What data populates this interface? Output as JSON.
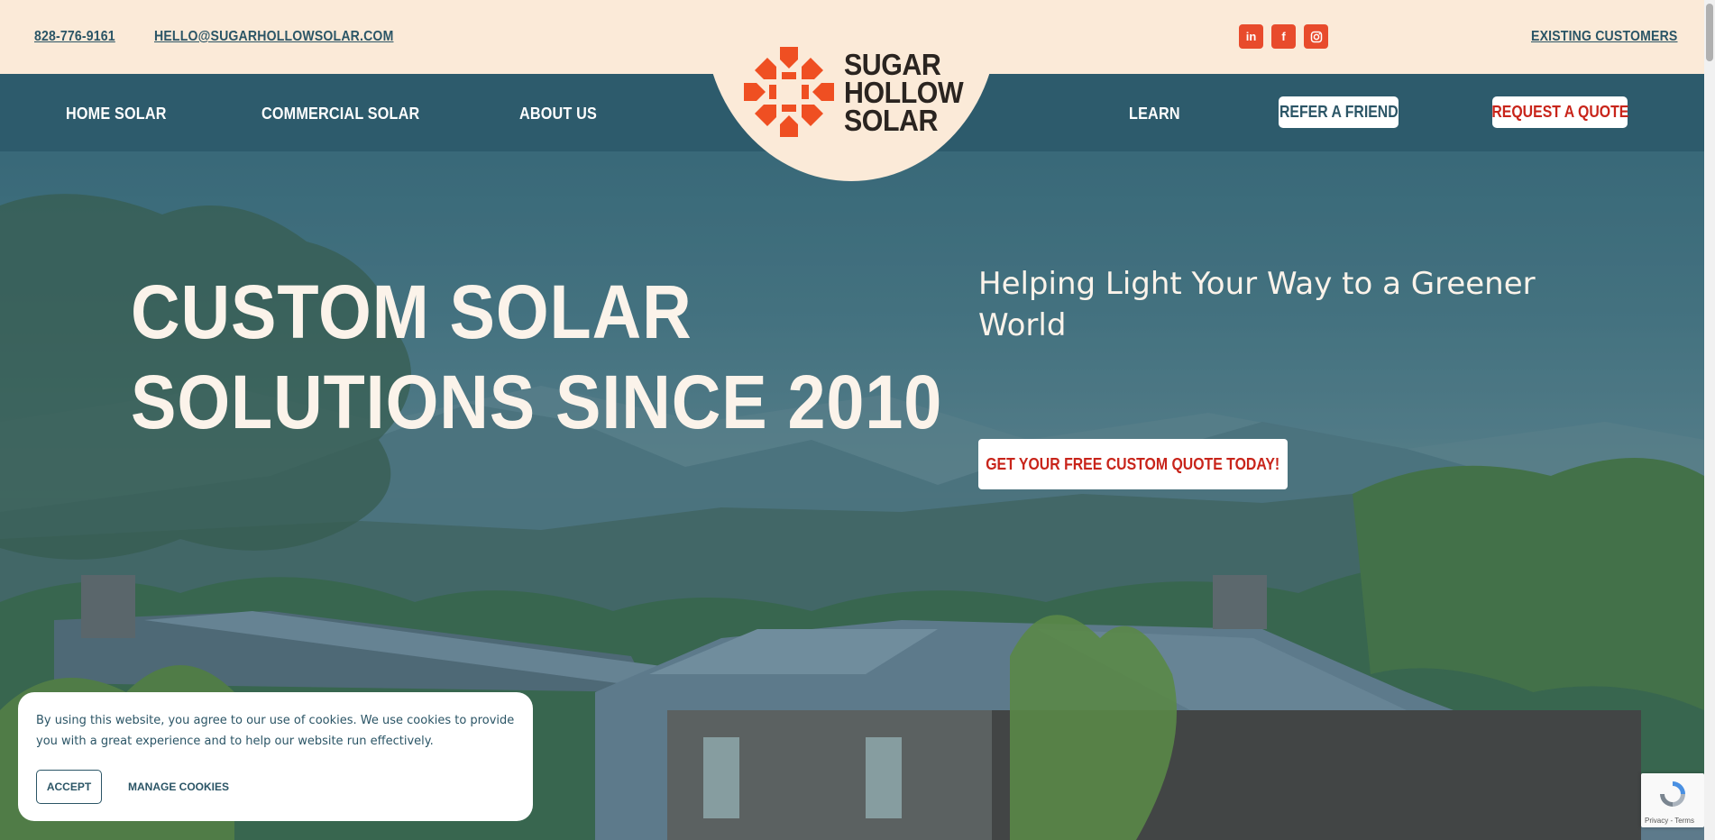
{
  "topbar": {
    "phone": "828-776-9161",
    "email": "HELLO@SUGARHOLLOWSOLAR.COM",
    "existing_customers": "EXISTING CUSTOMERS",
    "social": [
      "in",
      "f",
      "ig"
    ]
  },
  "nav": {
    "home_solar": "HOME SOLAR",
    "commercial_solar": "COMMERCIAL SOLAR",
    "about_us": "ABOUT US",
    "learn": "LEARN",
    "refer": "REFER A FRIEND",
    "request_quote": "REQUEST A QUOTE"
  },
  "logo": {
    "line1": "SUGAR",
    "line2": "HOLLOW",
    "line3": "SOLAR"
  },
  "hero": {
    "headline_line1": "CUSTOM SOLAR",
    "headline_line2": "SOLUTIONS SINCE 2010",
    "tagline": "Helping Light Your Way to a Greener World",
    "cta": "GET YOUR FREE CUSTOM QUOTE TODAY!"
  },
  "cookie": {
    "text": "By using this website, you agree to our use of cookies. We use cookies to provide you with a great experience and to help our website run effectively.",
    "accept": "ACCEPT",
    "manage": "MANAGE COOKIES"
  },
  "recaptcha": {
    "text": "Privacy - Terms"
  },
  "colors": {
    "cream": "#fbead8",
    "teal": "#2d5b6c",
    "orange": "#e84b2c",
    "red": "#c8241a"
  }
}
